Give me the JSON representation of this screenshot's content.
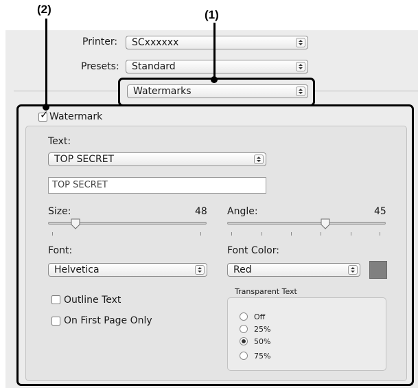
{
  "callouts": {
    "one": "(1)",
    "two": "(2)"
  },
  "printer": {
    "label": "Printer:",
    "value": "SCxxxxxx"
  },
  "presets": {
    "label": "Presets:",
    "value": "Standard"
  },
  "panel_select": {
    "value": "Watermarks"
  },
  "watermark": {
    "checkbox_label": "Watermark",
    "checked": true,
    "text_label": "Text:",
    "text_select": "TOP SECRET",
    "text_field_value": "TOP SECRET",
    "size_label": "Size:",
    "size_value": "48",
    "angle_label": "Angle:",
    "angle_value": "45",
    "font_label": "Font:",
    "font_value": "Helvetica",
    "font_color_label": "Font Color:",
    "font_color_value": "Red",
    "outline_text_label": "Outline Text",
    "outline_text_checked": false,
    "first_page_only_label": "On First Page Only",
    "first_page_only_checked": false,
    "transparent": {
      "title": "Transparent Text",
      "options": [
        "Off",
        "25%",
        "50%",
        "75%"
      ],
      "selected": "50%"
    }
  },
  "colors": {
    "swatch": "#808080",
    "highlight": "#000000"
  }
}
